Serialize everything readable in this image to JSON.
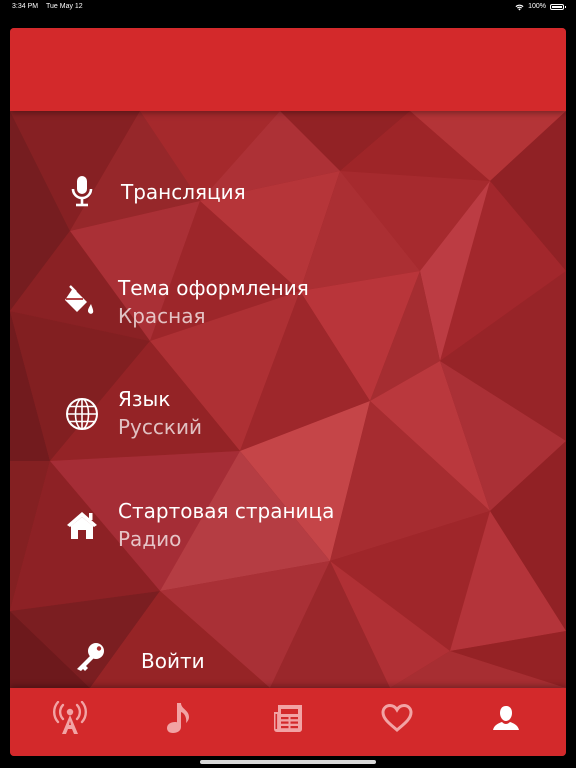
{
  "status_bar": {
    "time": "3:34 PM",
    "date": "Tue May 12",
    "battery": "100%"
  },
  "colors": {
    "header": "#d3292b",
    "tabbar": "#d3292b",
    "background": "#a92a2c",
    "tab_active": "#ffffff",
    "tab_inactive": "#f2a3a4"
  },
  "menu": {
    "broadcast": {
      "title": "Трансляция",
      "icon": "microphone-icon"
    },
    "theme": {
      "title": "Тема оформления",
      "value": "Красная",
      "icon": "paint-bucket-icon"
    },
    "language": {
      "title": "Язык",
      "value": "Русский",
      "icon": "globe-icon"
    },
    "start_page": {
      "title": "Стартовая страница",
      "value": "Радио",
      "icon": "home-icon"
    },
    "login": {
      "title": "Войти",
      "icon": "key-icon"
    }
  },
  "tabs": [
    {
      "name": "radio",
      "icon": "radio-tower-icon",
      "active": false
    },
    {
      "name": "music",
      "icon": "music-note-icon",
      "active": false
    },
    {
      "name": "news",
      "icon": "newspaper-icon",
      "active": false
    },
    {
      "name": "favorites",
      "icon": "heart-icon",
      "active": false
    },
    {
      "name": "profile",
      "icon": "user-icon",
      "active": true
    }
  ]
}
